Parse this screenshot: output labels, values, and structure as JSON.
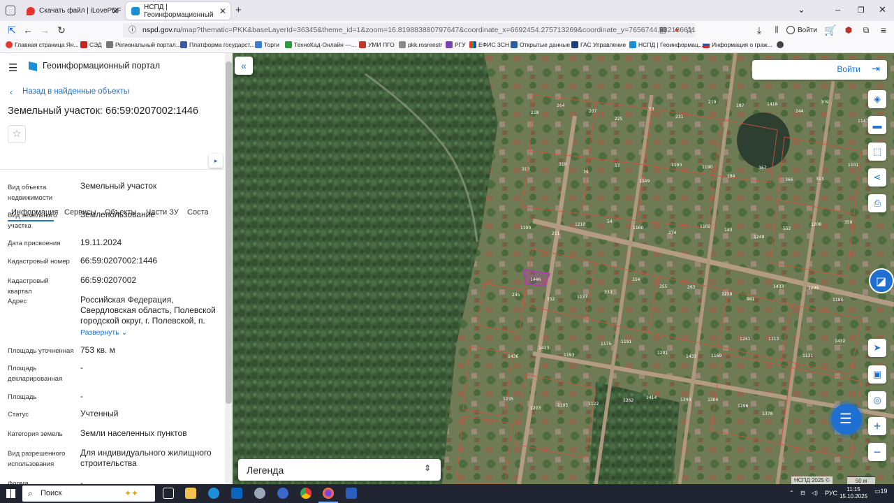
{
  "browser": {
    "tabs": [
      {
        "label": "Скачать файл | iLovePDF",
        "active": false
      },
      {
        "label": "НСПД | Геоинформационный",
        "active": true
      }
    ],
    "url_domain": "nspd.gov.ru",
    "url_rest": "/map?thematic=PKK&baseLayerId=36345&theme_id=1&zoom=16.819883880797647&coordinate_x=6692454.275713269&coordinate_y=7656744.932186611&is_co",
    "account_label": "Войти",
    "bookmarks": [
      "Главная страница Ян...",
      "СЭД",
      "Региональный портал...",
      "Платформа государст...",
      "Торги",
      "ТехноКад-Онлайн —...",
      "УМИ ПГО",
      "pkk.rosreestr",
      "РГУ",
      "ЕФИС ЗСН",
      "Открытые данные",
      "ГАС Управление",
      "НСПД | Геоинформац...",
      "Информация о граж..."
    ]
  },
  "panel": {
    "portal_title": "Геоинформационный портал",
    "back_link": "Назад в найденные объекты",
    "object_title": "Земельный участок: 66:59:0207002:1446",
    "tabs": [
      "Информация",
      "Сервисы",
      "Объекты",
      "Части ЗУ",
      "Состав"
    ],
    "fields": [
      {
        "label": "Вид объекта недвижимости",
        "value": "Земельный участок"
      },
      {
        "label": "Вид земельного участка",
        "value": "Землепользование"
      },
      {
        "label": "Дата присвоения",
        "value": "19.11.2024"
      },
      {
        "label": "Кадастровый номер",
        "value": "66:59:0207002:1446"
      },
      {
        "label": "Кадастровый квартал",
        "value": "66:59:0207002"
      },
      {
        "label": "Адрес",
        "value": "Российская Федерация, Свердловская область, Полевской городской округ, г. Полевской, п."
      },
      {
        "label": "Площадь уточненная",
        "value": "753 кв. м"
      },
      {
        "label": "Площадь декларированная",
        "value": "-"
      },
      {
        "label": "Площадь",
        "value": "-"
      },
      {
        "label": "Статус",
        "value": "Учтенный"
      },
      {
        "label": "Категория земель",
        "value": "Земли населенных пунктов"
      },
      {
        "label": "Вид разрешенного использования",
        "value": "Для индивидуального жилищного строительства"
      },
      {
        "label": "Форма собственности",
        "value": "-"
      }
    ],
    "expand_link": "Развернуть"
  },
  "map": {
    "login_label": "Войти",
    "legend_label": "Легенда",
    "selected_plot_label": "1446",
    "attribution": "НСПД 2025 ©",
    "scale_label": "50 м",
    "plot_labels": [
      "218",
      "264",
      "207",
      "225",
      "53",
      "231",
      "219",
      "187",
      "1416",
      "244",
      "309",
      "1147",
      "313",
      "310",
      "39",
      "17",
      "1149",
      "1193",
      "1190",
      "184",
      "367",
      "366",
      "313",
      "1101",
      "1100",
      "211",
      "1210",
      "54",
      "1160",
      "274",
      "1102",
      "143",
      "1249",
      "552",
      "1209",
      "359",
      "245",
      "152",
      "1137",
      "333",
      "354",
      "355",
      "263",
      "1239",
      "981",
      "1433",
      "1236",
      "1185",
      "1436",
      "1413",
      "1193",
      "1175",
      "1191",
      "1201",
      "1433",
      "1169",
      "1241",
      "1113",
      "1131",
      "1432",
      "1235",
      "1203",
      "1105",
      "1122",
      "1262",
      "1414",
      "1340",
      "1304",
      "1296",
      "1378"
    ],
    "accent": "#1f6fd1",
    "selected_color": "#b03ab8"
  },
  "taskbar": {
    "search_label": "Поиск",
    "language": "РУС",
    "time": "11:15",
    "date": "15.10.2025",
    "notif_count": "19"
  }
}
